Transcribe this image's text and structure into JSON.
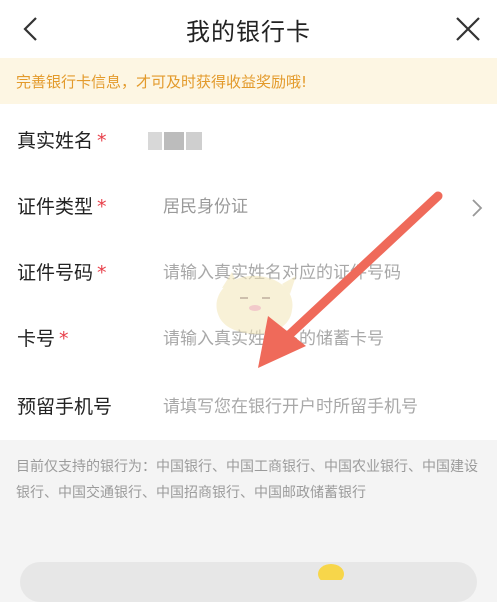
{
  "header": {
    "title": "我的银行卡",
    "back_icon": "chevron-left-icon",
    "close_icon": "close-icon"
  },
  "notice": {
    "text": "完善银行卡信息，才可及时获得收益奖励哦!"
  },
  "form": {
    "fields": [
      {
        "label": "真实姓名",
        "required": "*",
        "value": "",
        "masked": true
      },
      {
        "label": "证件类型",
        "required": "*",
        "value": "居民身份证",
        "has_chevron": true
      },
      {
        "label": "证件号码",
        "required": "*",
        "placeholder": "请输入真实姓名对应的证件号码"
      },
      {
        "label": "卡号",
        "required": "*",
        "placeholder": "请输入真实姓名下的储蓄卡号"
      },
      {
        "label": "预留手机号",
        "required": "",
        "placeholder": "请填写您在银行开户时所留手机号"
      }
    ]
  },
  "support": {
    "text": "目前仅支持的银行为：中国银行、中国工商银行、中国农业银行、中国建设银行、中国交通银行、中国招商银行、中国邮政储蓄银行"
  },
  "colors": {
    "notice_bg": "#fdf6e3",
    "notice_text": "#e39a2b",
    "required": "#e8404a",
    "arrow": "#ef6a5a"
  }
}
